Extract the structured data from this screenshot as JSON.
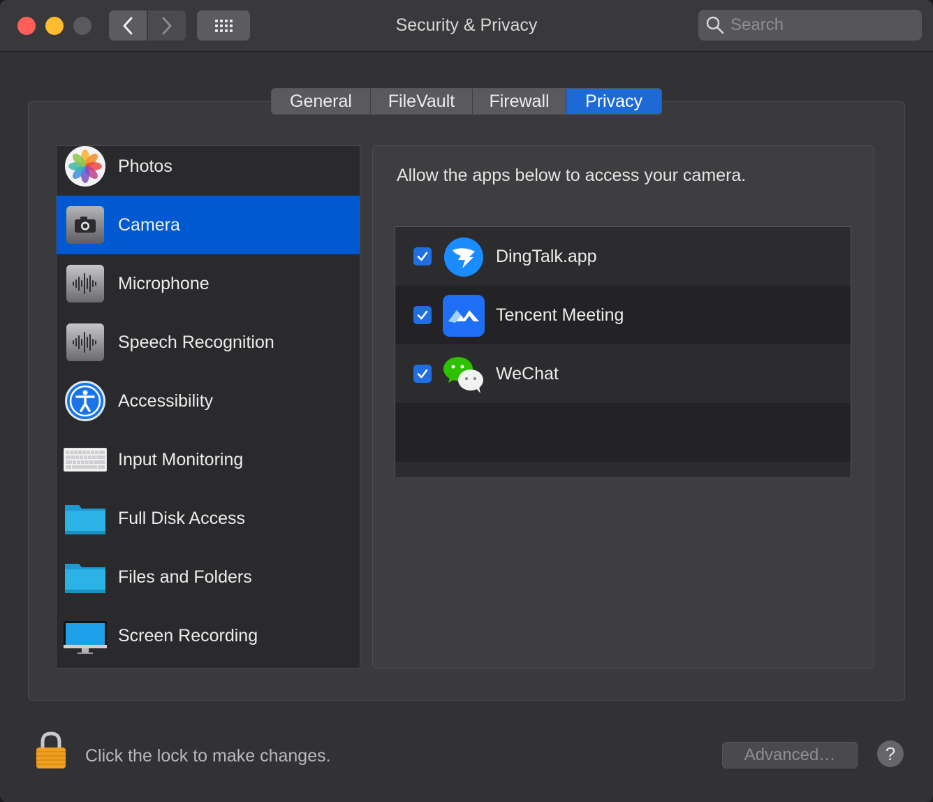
{
  "window": {
    "title": "Security & Privacy"
  },
  "toolbar": {
    "back_icon": "chevron-left-icon",
    "forward_icon": "chevron-right-icon",
    "grid_icon": "show-all-grid-icon"
  },
  "search": {
    "placeholder": "Search",
    "icon": "search-icon"
  },
  "tabs": [
    {
      "label": "General",
      "active": false
    },
    {
      "label": "FileVault",
      "active": false
    },
    {
      "label": "Firewall",
      "active": false
    },
    {
      "label": "Privacy",
      "active": true
    }
  ],
  "sidebar": {
    "items": [
      {
        "label": "Photos",
        "icon": "photos-icon",
        "selected": false
      },
      {
        "label": "Camera",
        "icon": "camera-icon",
        "selected": true
      },
      {
        "label": "Microphone",
        "icon": "microphone-icon",
        "selected": false
      },
      {
        "label": "Speech Recognition",
        "icon": "speech-recognition-icon",
        "selected": false
      },
      {
        "label": "Accessibility",
        "icon": "accessibility-icon",
        "selected": false
      },
      {
        "label": "Input Monitoring",
        "icon": "keyboard-icon",
        "selected": false
      },
      {
        "label": "Full Disk Access",
        "icon": "folder-icon",
        "selected": false
      },
      {
        "label": "Files and Folders",
        "icon": "folder-icon",
        "selected": false
      },
      {
        "label": "Screen Recording",
        "icon": "display-icon",
        "selected": false
      }
    ]
  },
  "main": {
    "message": "Allow the apps below to access your camera.",
    "apps": [
      {
        "label": "DingTalk.app",
        "icon": "dingtalk-icon",
        "checked": true
      },
      {
        "label": "Tencent Meeting",
        "icon": "tencent-meeting-icon",
        "checked": true
      },
      {
        "label": "WeChat",
        "icon": "wechat-icon",
        "checked": true
      }
    ]
  },
  "footer": {
    "lock_text": "Click the lock to make changes.",
    "advanced_label": "Advanced…",
    "help_label": "?"
  },
  "colors": {
    "accent": "#0059d1",
    "tab_active": "#1d69d6",
    "checkbox": "#1f6fe0"
  }
}
